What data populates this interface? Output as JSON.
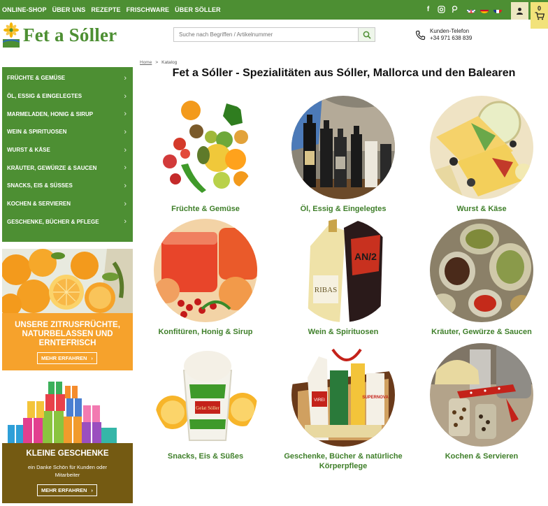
{
  "top_nav": [
    "ONLINE-SHOP",
    "ÜBER UNS",
    "REZEPTE",
    "FRISCHWARE",
    "ÜBER SÖLLER"
  ],
  "social_icons": [
    "facebook-icon",
    "instagram-icon",
    "pinterest-icon"
  ],
  "language_flags": [
    "english-flag",
    "spanish-flag",
    "french-flag"
  ],
  "cart": {
    "count": "0"
  },
  "logo": {
    "text": "Fet a Sóller"
  },
  "search": {
    "placeholder": "Suche nach Begriffen / Artikelnummer"
  },
  "phone": {
    "label": "Kunden-Telefon",
    "number": "+34 971 638 839"
  },
  "sidebar": {
    "categories": [
      "FRÜCHTE & GEMÜSE",
      "ÖL, ESSIG & EINGELEGTES",
      "MARMELADEN, HONIG & SIRUP",
      "WEIN & SPIRITUOSEN",
      "WURST & KÄSE",
      "KRÄUTER, GEWÜRZE & SAUCEN",
      "SNACKS, EIS & SÜSSES",
      "KOCHEN & SERVIEREN",
      "GESCHENKE, BÜCHER & PFLEGE"
    ]
  },
  "promo_citrus": {
    "title": "UNSERE ZITRUSFRÜCHTE, NATURBELASSEN UND ERNTEFRISCH",
    "button": "MEHR ERFAHREN"
  },
  "promo_gifts": {
    "title": "KLEINE GESCHENKE",
    "subtitle": "ein Danke Schön für Kunden oder Mitarbeiter",
    "button": "MEHR ERFAHREN"
  },
  "breadcrumb": {
    "home": "Home",
    "separator": ">",
    "current": "Katalog"
  },
  "page_title": "Fet a Sóller - Spezialitäten aus Sóller, Mallorca und den Balearen",
  "categories": [
    {
      "label": "Früchte & Gemüse"
    },
    {
      "label": "Öl, Essig & Eingelegtes"
    },
    {
      "label": "Wurst & Käse"
    },
    {
      "label": "Konfitüren, Honig & Sirup"
    },
    {
      "label": "Wein & Spirituosen"
    },
    {
      "label": "Kräuter, Gewürze & Saucen"
    },
    {
      "label": "Snacks, Eis & Süßes"
    },
    {
      "label": "Geschenke, Bücher & natürliche Körperpflege"
    },
    {
      "label": "Kochen & Servieren"
    }
  ],
  "image_text": {
    "wine_label": "RIBAS",
    "wine_label_2": "AN/2",
    "ice_cream": "Gelat Sóller",
    "gift_bottle": "VIREI",
    "gift_pack": "SUPERNOVA"
  },
  "colors": {
    "brand_green": "#4d8f33",
    "promo_orange": "#f6a22c",
    "promo_brown": "#745a12",
    "label_green": "#3f7f2a"
  }
}
